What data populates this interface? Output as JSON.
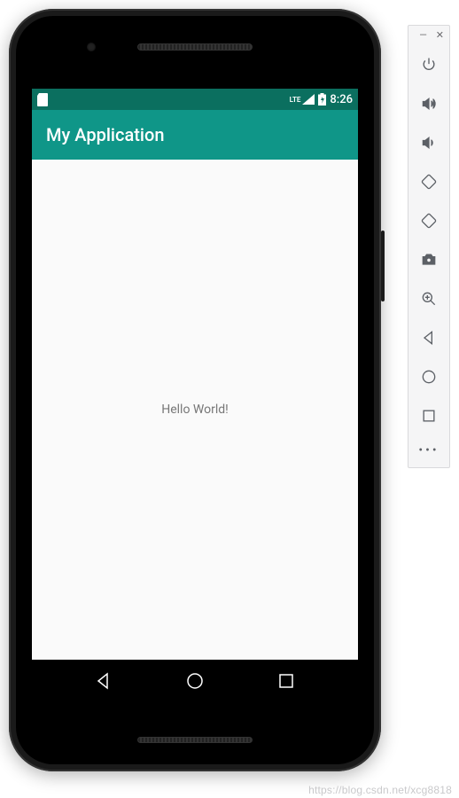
{
  "status": {
    "network": "LTE",
    "clock": "8:26"
  },
  "app": {
    "title": "My Application",
    "content_text": "Hello World!"
  },
  "toolbar": {
    "icons": [
      "power-icon",
      "volume-up-icon",
      "volume-down-icon",
      "rotate-left-icon",
      "rotate-right-icon",
      "camera-icon",
      "zoom-icon",
      "back-icon",
      "home-icon",
      "overview-icon",
      "more-icon"
    ]
  },
  "watermark": "https://blog.csdn.net/xcg8818"
}
